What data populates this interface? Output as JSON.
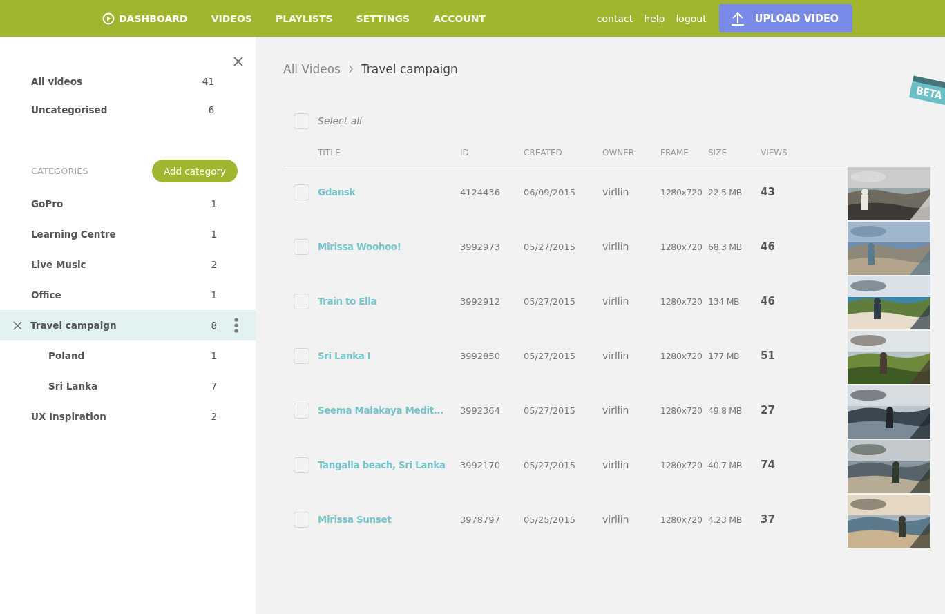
{
  "nav": {
    "items": [
      {
        "label": "DASHBOARD",
        "selected": true
      },
      {
        "label": "VIDEOS",
        "selected": false
      },
      {
        "label": "PLAYLISTS",
        "selected": false
      },
      {
        "label": "SETTINGS",
        "selected": false
      },
      {
        "label": "ACCOUNT",
        "selected": false
      }
    ],
    "links": [
      "contact",
      "help",
      "logout"
    ],
    "upload_button": "UPLOAD VIDEO"
  },
  "sidebar": {
    "library": [
      {
        "label": "All videos",
        "count": "41",
        "selected": false
      },
      {
        "label": "Uncategorised",
        "count": "6",
        "selected": false
      }
    ],
    "categories_heading": "CATEGORIES",
    "add_button": "Add category",
    "categories": [
      {
        "label": "GoPro",
        "count": "1",
        "selected": false
      },
      {
        "label": "Learning Centre",
        "count": "1",
        "selected": false
      },
      {
        "label": "Live Music",
        "count": "2",
        "selected": false
      },
      {
        "label": "Office",
        "count": "1",
        "selected": false
      },
      {
        "label": "Travel campaign",
        "count": "8",
        "selected": true,
        "children": [
          {
            "label": "Poland",
            "count": "1",
            "selected": false
          },
          {
            "label": "Sri Lanka",
            "count": "7",
            "selected": false
          }
        ]
      },
      {
        "label": "UX Inspiration",
        "count": "2",
        "selected": false
      }
    ]
  },
  "breadcrumb": [
    "All Videos",
    "Travel campaign"
  ],
  "beta_badge": "BETA",
  "select_all": {
    "label": "Select all",
    "checked": false
  },
  "table": {
    "columns": [
      "TITLE",
      "ID",
      "CREATED",
      "OWNER",
      "FRAME",
      "SIZE",
      "VIEWS"
    ],
    "rows": [
      {
        "checked": false,
        "title": "Gdansk",
        "id": "4124436",
        "created": "06/09/2015",
        "owner": "virllin",
        "frame": "1280x720",
        "size": "22.5 MB",
        "views": "43"
      },
      {
        "checked": false,
        "title": "Mirissa Woohoo!",
        "id": "3992973",
        "created": "05/27/2015",
        "owner": "virllin",
        "frame": "1280x720",
        "size": "68.3 MB",
        "views": "46"
      },
      {
        "checked": false,
        "title": "Train to Ella",
        "id": "3992912",
        "created": "05/27/2015",
        "owner": "virllin",
        "frame": "1280x720",
        "size": "134 MB",
        "views": "46"
      },
      {
        "checked": false,
        "title": "Sri Lanka I",
        "id": "3992850",
        "created": "05/27/2015",
        "owner": "virllin",
        "frame": "1280x720",
        "size": "177 MB",
        "views": "51"
      },
      {
        "checked": false,
        "title": "Seema Malakaya Medit...",
        "id": "3992364",
        "created": "05/27/2015",
        "owner": "virllin",
        "frame": "1280x720",
        "size": "49.8 MB",
        "views": "27"
      },
      {
        "checked": false,
        "title": "Tangalla beach, Sri Lanka",
        "id": "3992170",
        "created": "05/27/2015",
        "owner": "virllin",
        "frame": "1280x720",
        "size": "40.7 MB",
        "views": "74"
      },
      {
        "checked": false,
        "title": "Mirissa Sunset",
        "id": "3978797",
        "created": "05/25/2015",
        "owner": "virllin",
        "frame": "1280x720",
        "size": "4.23 MB",
        "views": "37"
      }
    ]
  }
}
